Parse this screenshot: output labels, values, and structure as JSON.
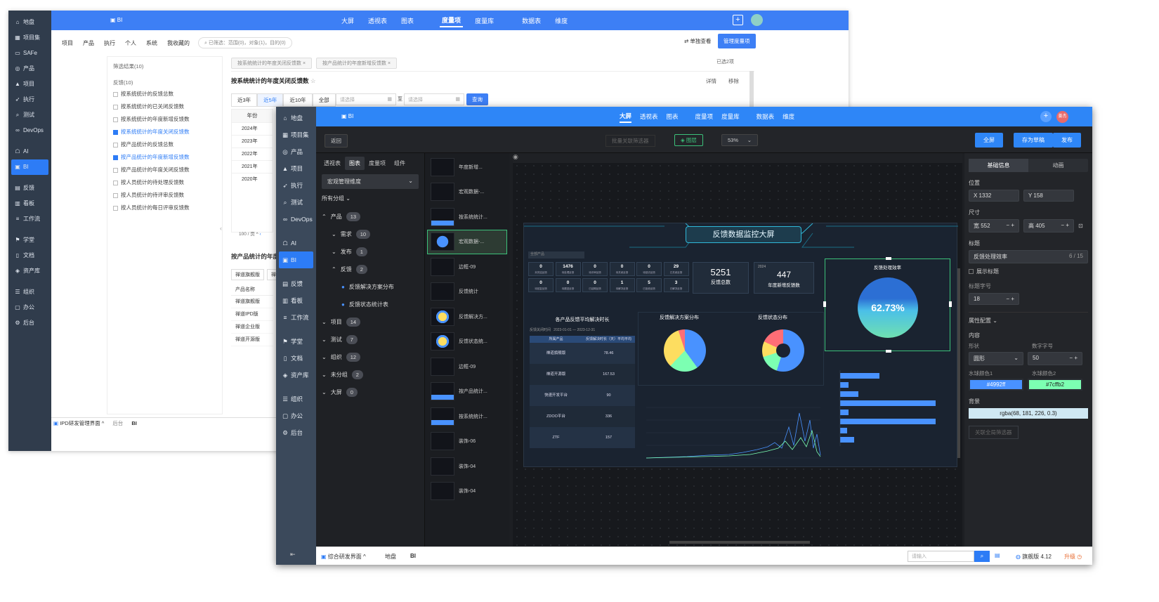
{
  "back": {
    "sidebar": [
      "地盘",
      "项目集",
      "SAFe",
      "产品",
      "项目",
      "执行",
      "测试",
      "DevOps",
      "AI",
      "BI",
      "反馈",
      "看板",
      "工作流",
      "学堂",
      "文档",
      "资产库",
      "组织",
      "办公",
      "后台"
    ],
    "sidebar_icons": [
      "home-icon",
      "grid-icon",
      "folder-icon",
      "location-icon",
      "project-icon",
      "send-icon",
      "search-icon",
      "infinity-icon",
      "robot-icon",
      "chart-icon",
      "feedback-icon",
      "board-icon",
      "workflow-icon",
      "school-icon",
      "doc-icon",
      "asset-icon",
      "org-icon",
      "office-icon",
      "settings-icon"
    ],
    "logo": "BI",
    "top_nav": [
      "大屏",
      "透视表",
      "图表",
      "度量项",
      "度量库",
      "数据表",
      "维度"
    ],
    "top_active": "度量项",
    "filter_tabs": [
      "项目",
      "产品",
      "执行",
      "个人",
      "系统",
      "我收藏的"
    ],
    "filter_summary": "已筛选：范围(0)，对象(1)，目的(0)",
    "single_view": "单独查看",
    "manage_button": "管理度量项",
    "result_title": "筛选结果(10)",
    "group": "反馈(10)",
    "items": [
      "按系统统计的反馈总数",
      "按系统统计的已关闭反馈数",
      "按系统统计的年度新增反馈数",
      "按系统统计的年度关闭反馈数",
      "按产品统计的反馈总数",
      "按产品统计的年度新增反馈数",
      "按产品统计的年度关闭反馈数",
      "按人员统计的待处理反馈数",
      "按人员统计的待评审反馈数",
      "按人员统计的每日评审反馈数"
    ],
    "chips": [
      "按系统统计的年度关闭反馈数",
      "按产品统计的年度新增反馈数"
    ],
    "selected_count": "已选2项",
    "metric_title": "按系统统计的年度关闭反馈数",
    "detail": "详情",
    "remove": "移除",
    "ranges": [
      "近3年",
      "近5年",
      "近10年",
      "全部"
    ],
    "placeholder": "请选择",
    "to": "至",
    "query": "查询",
    "year_header": "年份",
    "years": [
      "2024年",
      "2023年",
      "2022年",
      "2021年",
      "2020年"
    ],
    "pager": "100 / 页",
    "metric2_title": "按产品统计的年度",
    "product_tabs": [
      "禅道旗舰版",
      "禅道"
    ],
    "product_header": "产品名称",
    "products": [
      "禅道旗舰版",
      "禅道IPD版",
      "禅道企业版",
      "禅道开源版"
    ],
    "status_app": "IPD研发管理界面",
    "status_crumbs": [
      "后台",
      "BI"
    ]
  },
  "front": {
    "sidebar": [
      "地盘",
      "项目集",
      "产品",
      "项目",
      "执行",
      "测试",
      "DevOps",
      "AI",
      "BI",
      "反馈",
      "看板",
      "工作流",
      "学堂",
      "文档",
      "资产库",
      "组织",
      "办公",
      "后台"
    ],
    "sidebar_icons": [
      "home-icon",
      "grid-icon",
      "location-icon",
      "project-icon",
      "send-icon",
      "search-icon",
      "infinity-icon",
      "robot-icon",
      "chart-icon",
      "feedback-icon",
      "board-icon",
      "workflow-icon",
      "school-icon",
      "doc-icon",
      "asset-icon",
      "org-icon",
      "office-icon",
      "settings-icon"
    ],
    "logo": "BI",
    "avatar": "姜杰",
    "top_nav": [
      "大屏",
      "透视表",
      "图表",
      "度量项",
      "度量库",
      "数据表",
      "维度"
    ],
    "back": "返回",
    "batch": "批量关联筛选器",
    "layers": "图层",
    "zoom": "53%",
    "fullscreen": "全屏",
    "save_draft": "存为草稿",
    "publish": "发布",
    "lp_tabs": [
      "透视表",
      "图表",
      "度量项",
      "组件"
    ],
    "dimension": "宏观管理维度",
    "all_groups": "所有分组",
    "tree": [
      {
        "label": "产品",
        "count": "13",
        "lvl": 0,
        "open": true
      },
      {
        "label": "需求",
        "count": "10",
        "lvl": 1
      },
      {
        "label": "发布",
        "count": "1",
        "lvl": 1
      },
      {
        "label": "反馈",
        "count": "2",
        "lvl": 1,
        "open": true
      },
      {
        "label": "反馈解决方案分布",
        "lvl": 2
      },
      {
        "label": "反馈状态统计表",
        "lvl": 2
      },
      {
        "label": "项目",
        "count": "14",
        "lvl": 0
      },
      {
        "label": "测试",
        "count": "7",
        "lvl": 0
      },
      {
        "label": "组织",
        "count": "12",
        "lvl": 0
      },
      {
        "label": "未分组",
        "count": "2",
        "lvl": 0
      },
      {
        "label": "大屏",
        "count": "0",
        "lvl": 0
      }
    ],
    "thumbs": [
      "年度新增...",
      "宏观数据-...",
      "按系统统计...",
      "宏观数据-...",
      "边框-09",
      "反馈统计",
      "反馈解决方...",
      "反馈状态统...",
      "边框-09",
      "按产品统计...",
      "按系统统计...",
      "装饰-06",
      "装饰-04",
      "装饰-04"
    ],
    "dash": {
      "title": "反馈数据监控大屏",
      "kpi_values": [
        "0",
        "1476",
        "0",
        "0",
        "0",
        "29",
        "0",
        "0",
        "0",
        "1",
        "5",
        "3"
      ],
      "kpi_labels": [
        "未完结反馈",
        "待处理反馈",
        "待评审反馈",
        "待关闭反馈",
        "待回访反馈",
        "已关闭反馈",
        "待回复反馈",
        "待跟进反馈",
        "已延期反馈",
        "待解决反馈",
        "已拒绝反馈",
        "已解决反馈"
      ],
      "total": "5251",
      "total_label": "反馈总数",
      "year": "2024",
      "year_new": "447",
      "year_new_label": "年度新增反馈数",
      "gauge_title": "反馈处理效率",
      "gauge_value": "62.73%",
      "table_title": "各产品反馈平均解决时长",
      "table_headers": [
        "所属产品",
        "反馈解决时长（天）平均平均"
      ],
      "table_rows": [
        [
          "禅道旗舰版",
          "78.46"
        ],
        [
          "禅道开源版",
          "167.53"
        ],
        [
          "快速开发平台",
          "90"
        ],
        [
          "ZDOO平台",
          "336"
        ],
        [
          "ZTF",
          "157"
        ]
      ],
      "pie1_title": "反馈解决方案分布",
      "pie2_title": "反馈状态分布"
    },
    "props": {
      "tab_basic": "基础信息",
      "tab_anim": "动画",
      "position": "位置",
      "x": "X 1332",
      "y": "Y 158",
      "size": "尺寸",
      "w": "宽 552",
      "h": "高 405",
      "title_label": "标题",
      "title_value": "反馈处理效率",
      "title_count": "6 / 15",
      "show_title": "展示标题",
      "font_label": "标题字号",
      "font_value": "18",
      "attr": "属性配置",
      "content": "内容",
      "shape_label": "形状",
      "shape_value": "圆形",
      "num_font_label": "数字字号",
      "num_font_value": "50",
      "color1_label": "水球颜色1",
      "color1": "#4992ff",
      "color2_label": "水球颜色2",
      "color2": "#7cffb2",
      "bg_label": "背景",
      "bg_value": "rgba(68, 181, 226, 0.3)",
      "link_filter": "关联全局筛选器"
    },
    "status": {
      "app": "综合研发界面",
      "crumbs": [
        "地盘",
        "BI"
      ],
      "search_placeholder": "请输入",
      "version": "旗舰版 4.12",
      "upgrade": "升级"
    }
  }
}
